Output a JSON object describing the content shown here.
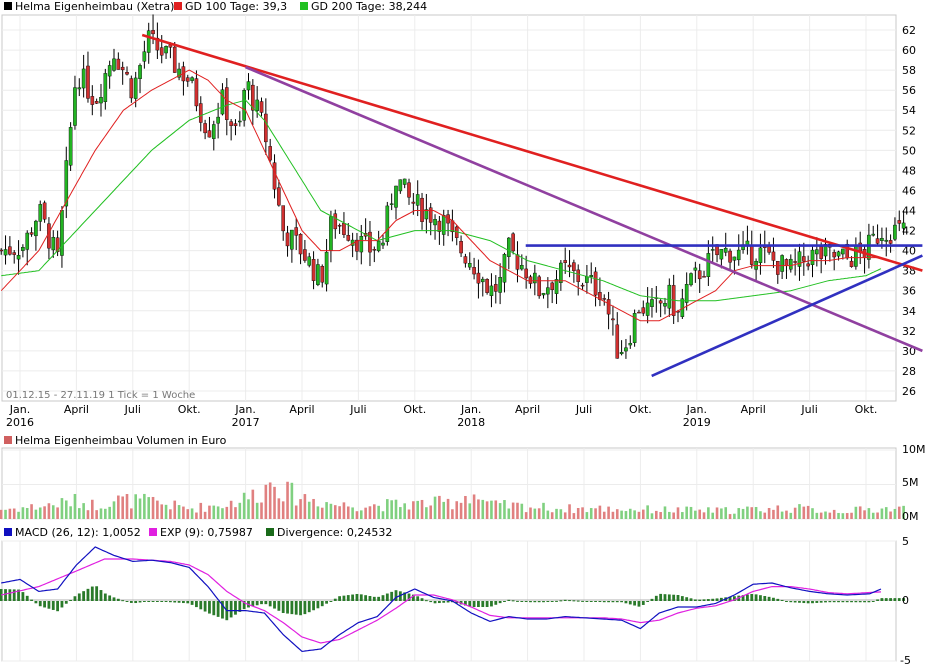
{
  "chart_data": {
    "type": "candlestick",
    "price_panel": {
      "legend": [
        {
          "label": "Helma Eigenheimbau (Xetra)",
          "color": "#000000"
        },
        {
          "label": "GD 100 Tage: 39,3",
          "color": "#e02020"
        },
        {
          "label": "GD 200 Tage: 38,244",
          "color": "#22c022"
        }
      ],
      "y_ticks": [
        26,
        28,
        30,
        32,
        34,
        36,
        38,
        40,
        42,
        44,
        46,
        48,
        50,
        52,
        54,
        56,
        58,
        60,
        62
      ],
      "ylim": [
        25,
        63.5
      ],
      "x_labels": [
        {
          "m": 1,
          "top": "Jan.",
          "bottom": "2016"
        },
        {
          "m": 4,
          "top": "April"
        },
        {
          "m": 7,
          "top": "Juli"
        },
        {
          "m": 10,
          "top": "Okt."
        },
        {
          "m": 13,
          "top": "Jan.",
          "bottom": "2017"
        },
        {
          "m": 16,
          "top": "April"
        },
        {
          "m": 19,
          "top": "Juli"
        },
        {
          "m": 22,
          "top": "Okt."
        },
        {
          "m": 25,
          "top": "Jan.",
          "bottom": "2018"
        },
        {
          "m": 28,
          "top": "April"
        },
        {
          "m": 31,
          "top": "Juli"
        },
        {
          "m": 34,
          "top": "Okt."
        },
        {
          "m": 37,
          "top": "Jan.",
          "bottom": "2019"
        },
        {
          "m": 40,
          "top": "April"
        },
        {
          "m": 43,
          "top": "Juli"
        },
        {
          "m": 46,
          "top": "Okt."
        }
      ],
      "info_text": "01.12.15 - 27.11.19   1 Tick = 1 Woche",
      "close_anchors": [
        [
          0,
          40
        ],
        [
          1.2,
          40.5
        ],
        [
          2.0,
          44
        ],
        [
          3.0,
          39
        ],
        [
          4.0,
          58
        ],
        [
          5.0,
          55
        ],
        [
          6.0,
          60
        ],
        [
          7.0,
          56
        ],
        [
          7.8,
          61
        ],
        [
          9.0,
          59
        ],
        [
          10.0,
          57
        ],
        [
          11.0,
          52
        ],
        [
          11.8,
          55
        ],
        [
          12.6,
          51
        ],
        [
          13.0,
          57
        ],
        [
          14.0,
          52
        ],
        [
          15.0,
          42
        ],
        [
          16.0,
          40
        ],
        [
          17.0,
          37
        ],
        [
          17.6,
          43
        ],
        [
          18.5,
          42
        ],
        [
          19.5,
          40
        ],
        [
          20.3,
          41
        ],
        [
          21.0,
          47.5
        ],
        [
          21.7,
          45
        ],
        [
          22.5,
          44
        ],
        [
          23.5,
          43
        ],
        [
          24.0,
          41
        ],
        [
          25.0,
          39
        ],
        [
          26.0,
          36
        ],
        [
          26.5,
          36.5
        ],
        [
          27.0,
          40
        ],
        [
          28.0,
          38
        ],
        [
          28.6,
          36
        ],
        [
          29.3,
          37
        ],
        [
          30.0,
          38
        ],
        [
          31.0,
          37
        ],
        [
          32.0,
          36
        ],
        [
          32.8,
          30
        ],
        [
          33.3,
          31
        ],
        [
          33.9,
          34.5
        ],
        [
          34.7,
          34
        ],
        [
          35.5,
          35.5
        ],
        [
          36.0,
          33.5
        ],
        [
          36.4,
          36
        ],
        [
          37.2,
          38
        ],
        [
          38.0,
          39.5
        ],
        [
          38.7,
          40
        ],
        [
          39.4,
          39.5
        ],
        [
          40.2,
          40
        ],
        [
          41.0,
          39
        ],
        [
          42.0,
          38
        ],
        [
          43.0,
          39.5
        ],
        [
          44.0,
          39.5
        ],
        [
          45.0,
          39.2
        ],
        [
          46.0,
          40
        ],
        [
          46.8,
          42
        ]
      ],
      "gd100_anchors": [
        [
          0,
          36
        ],
        [
          2,
          40
        ],
        [
          3.5,
          45
        ],
        [
          5,
          50
        ],
        [
          6.5,
          54
        ],
        [
          8,
          56
        ],
        [
          10,
          58
        ],
        [
          11,
          57
        ],
        [
          12,
          55
        ],
        [
          13,
          54
        ],
        [
          14,
          50
        ],
        [
          15,
          46
        ],
        [
          16,
          42
        ],
        [
          17,
          40
        ],
        [
          18,
          40
        ],
        [
          19,
          41
        ],
        [
          20,
          41
        ],
        [
          21,
          43
        ],
        [
          22,
          44
        ],
        [
          23,
          44
        ],
        [
          24,
          43
        ],
        [
          25,
          41
        ],
        [
          26,
          39
        ],
        [
          27,
          38
        ],
        [
          28,
          37
        ],
        [
          29,
          37
        ],
        [
          30,
          37
        ],
        [
          31,
          36
        ],
        [
          32,
          35
        ],
        [
          33,
          34
        ],
        [
          34,
          33
        ],
        [
          35,
          33
        ],
        [
          36,
          34
        ],
        [
          37,
          35
        ],
        [
          38,
          36
        ],
        [
          39,
          38
        ],
        [
          40,
          38.5
        ],
        [
          41,
          38.5
        ],
        [
          42,
          38.5
        ],
        [
          43,
          39
        ],
        [
          44,
          39
        ],
        [
          45,
          39.3
        ],
        [
          46.8,
          39.3
        ]
      ],
      "gd200_anchors": [
        [
          0,
          37.5
        ],
        [
          2,
          38
        ],
        [
          4,
          42
        ],
        [
          6,
          46
        ],
        [
          8,
          50
        ],
        [
          10,
          53
        ],
        [
          12,
          54.5
        ],
        [
          13,
          55
        ],
        [
          14,
          53
        ],
        [
          15,
          50
        ],
        [
          16,
          47
        ],
        [
          17,
          44
        ],
        [
          18,
          43
        ],
        [
          20,
          41
        ],
        [
          22,
          42
        ],
        [
          24,
          42
        ],
        [
          26,
          41
        ],
        [
          28,
          39
        ],
        [
          30,
          38
        ],
        [
          32,
          37
        ],
        [
          34,
          35.5
        ],
        [
          36,
          35
        ],
        [
          38,
          35
        ],
        [
          40,
          35.5
        ],
        [
          42,
          36
        ],
        [
          44,
          37
        ],
        [
          46,
          37.5
        ],
        [
          46.8,
          38.2
        ]
      ],
      "trendlines": [
        {
          "name": "resistance-line",
          "color": "#e02020",
          "from": [
            7.5,
            61.5
          ],
          "to": [
            49.0,
            38.0
          ]
        },
        {
          "name": "long-resistance-line",
          "color": "#9040a0",
          "from": [
            13.0,
            58.3
          ],
          "to": [
            49.0,
            30.0
          ]
        },
        {
          "name": "horizontal-line",
          "color": "#3030c0",
          "from": [
            27.9,
            40.5
          ],
          "to": [
            49.0,
            40.5
          ]
        },
        {
          "name": "support-line",
          "color": "#3030c0",
          "from": [
            34.6,
            27.5
          ],
          "to": [
            49.0,
            39.5
          ]
        }
      ]
    },
    "volume_panel": {
      "title": "Helma Eigenheimbau Volumen in Euro",
      "y_ticks": [
        "10M",
        "5M",
        "0M"
      ],
      "y_values": [
        10,
        5,
        0
      ],
      "ylim": [
        0,
        10
      ],
      "unit": "M EUR",
      "volume_anchors": [
        [
          0,
          1.4
        ],
        [
          2,
          1.8
        ],
        [
          4,
          2.6
        ],
        [
          5,
          2.0
        ],
        [
          6,
          2.8
        ],
        [
          8,
          2.5
        ],
        [
          10,
          1.5
        ],
        [
          12,
          2.2
        ],
        [
          13,
          3.0
        ],
        [
          14,
          4.2
        ],
        [
          14.6,
          6.5
        ],
        [
          15,
          4.0
        ],
        [
          16,
          3.2
        ],
        [
          18,
          2.0
        ],
        [
          20,
          2.0
        ],
        [
          22,
          2.2
        ],
        [
          24,
          2.4
        ],
        [
          25,
          3.8
        ],
        [
          26,
          2.0
        ],
        [
          28,
          1.8
        ],
        [
          30,
          1.5
        ],
        [
          32,
          1.5
        ],
        [
          34,
          1.4
        ],
        [
          36,
          1.3
        ],
        [
          38,
          1.2
        ],
        [
          40,
          1.4
        ],
        [
          42,
          1.6
        ],
        [
          44,
          1.2
        ],
        [
          46,
          1.3
        ],
        [
          46.8,
          1.5
        ]
      ]
    },
    "macd_panel": {
      "legend": [
        {
          "label": "MACD (26, 12): 1,0052",
          "color": "#1010c0"
        },
        {
          "label": "EXP (9): 0,75987",
          "color": "#e020e0"
        },
        {
          "label": "Divergence: 0,24532",
          "color": "#1a6a1a"
        }
      ],
      "y_ticks": [
        "5",
        "0",
        "-5"
      ],
      "y_values": [
        5,
        0,
        -5
      ],
      "ylim": [
        -5,
        5
      ],
      "macd_anchors": [
        [
          0,
          1.5
        ],
        [
          1,
          1.8
        ],
        [
          2,
          0.8
        ],
        [
          3,
          1.0
        ],
        [
          4,
          3.0
        ],
        [
          5,
          4.5
        ],
        [
          6,
          3.8
        ],
        [
          7,
          3.3
        ],
        [
          8,
          3.4
        ],
        [
          9,
          3.2
        ],
        [
          10,
          2.8
        ],
        [
          11,
          1.2
        ],
        [
          12,
          -0.8
        ],
        [
          13,
          -0.8
        ],
        [
          14,
          -1.0
        ],
        [
          15,
          -2.8
        ],
        [
          16,
          -4.2
        ],
        [
          17,
          -4.0
        ],
        [
          18,
          -2.8
        ],
        [
          19,
          -1.8
        ],
        [
          20,
          -1.3
        ],
        [
          21,
          0.3
        ],
        [
          22,
          1.0
        ],
        [
          23,
          0.3
        ],
        [
          24,
          0
        ],
        [
          25,
          -1.0
        ],
        [
          26,
          -1.7
        ],
        [
          27,
          -1.3
        ],
        [
          28,
          -1.5
        ],
        [
          29,
          -1.5
        ],
        [
          30,
          -1.3
        ],
        [
          31,
          -1.4
        ],
        [
          32,
          -1.5
        ],
        [
          33,
          -1.6
        ],
        [
          34,
          -2.3
        ],
        [
          35,
          -1.0
        ],
        [
          36,
          -0.5
        ],
        [
          37,
          -0.5
        ],
        [
          38,
          -0.2
        ],
        [
          39,
          0.5
        ],
        [
          40,
          1.4
        ],
        [
          41,
          1.5
        ],
        [
          42,
          1.1
        ],
        [
          43,
          0.8
        ],
        [
          44,
          0.6
        ],
        [
          45,
          0.5
        ],
        [
          46.2,
          0.6
        ],
        [
          46.8,
          1.0
        ]
      ],
      "exp_anchors": [
        [
          0,
          0.5
        ],
        [
          2,
          1.2
        ],
        [
          4,
          2.5
        ],
        [
          5.5,
          3.5
        ],
        [
          7,
          3.5
        ],
        [
          9,
          3.3
        ],
        [
          10,
          3.0
        ],
        [
          11,
          2.2
        ],
        [
          12,
          0.8
        ],
        [
          13,
          -0.2
        ],
        [
          14,
          -0.8
        ],
        [
          15,
          -1.8
        ],
        [
          16,
          -3.0
        ],
        [
          17,
          -3.5
        ],
        [
          18,
          -3.2
        ],
        [
          19,
          -2.4
        ],
        [
          20,
          -1.6
        ],
        [
          21,
          -0.6
        ],
        [
          22,
          0.5
        ],
        [
          23,
          0.5
        ],
        [
          24,
          0.1
        ],
        [
          25,
          -0.5
        ],
        [
          26,
          -1.2
        ],
        [
          27,
          -1.4
        ],
        [
          28,
          -1.4
        ],
        [
          30,
          -1.4
        ],
        [
          32,
          -1.4
        ],
        [
          33,
          -1.5
        ],
        [
          34,
          -1.8
        ],
        [
          35,
          -1.6
        ],
        [
          36,
          -1.0
        ],
        [
          37,
          -0.6
        ],
        [
          38,
          -0.4
        ],
        [
          39,
          0.1
        ],
        [
          40,
          0.8
        ],
        [
          41,
          1.2
        ],
        [
          42,
          1.2
        ],
        [
          43,
          1.0
        ],
        [
          44,
          0.7
        ],
        [
          45,
          0.6
        ],
        [
          46.8,
          0.76
        ]
      ]
    }
  }
}
